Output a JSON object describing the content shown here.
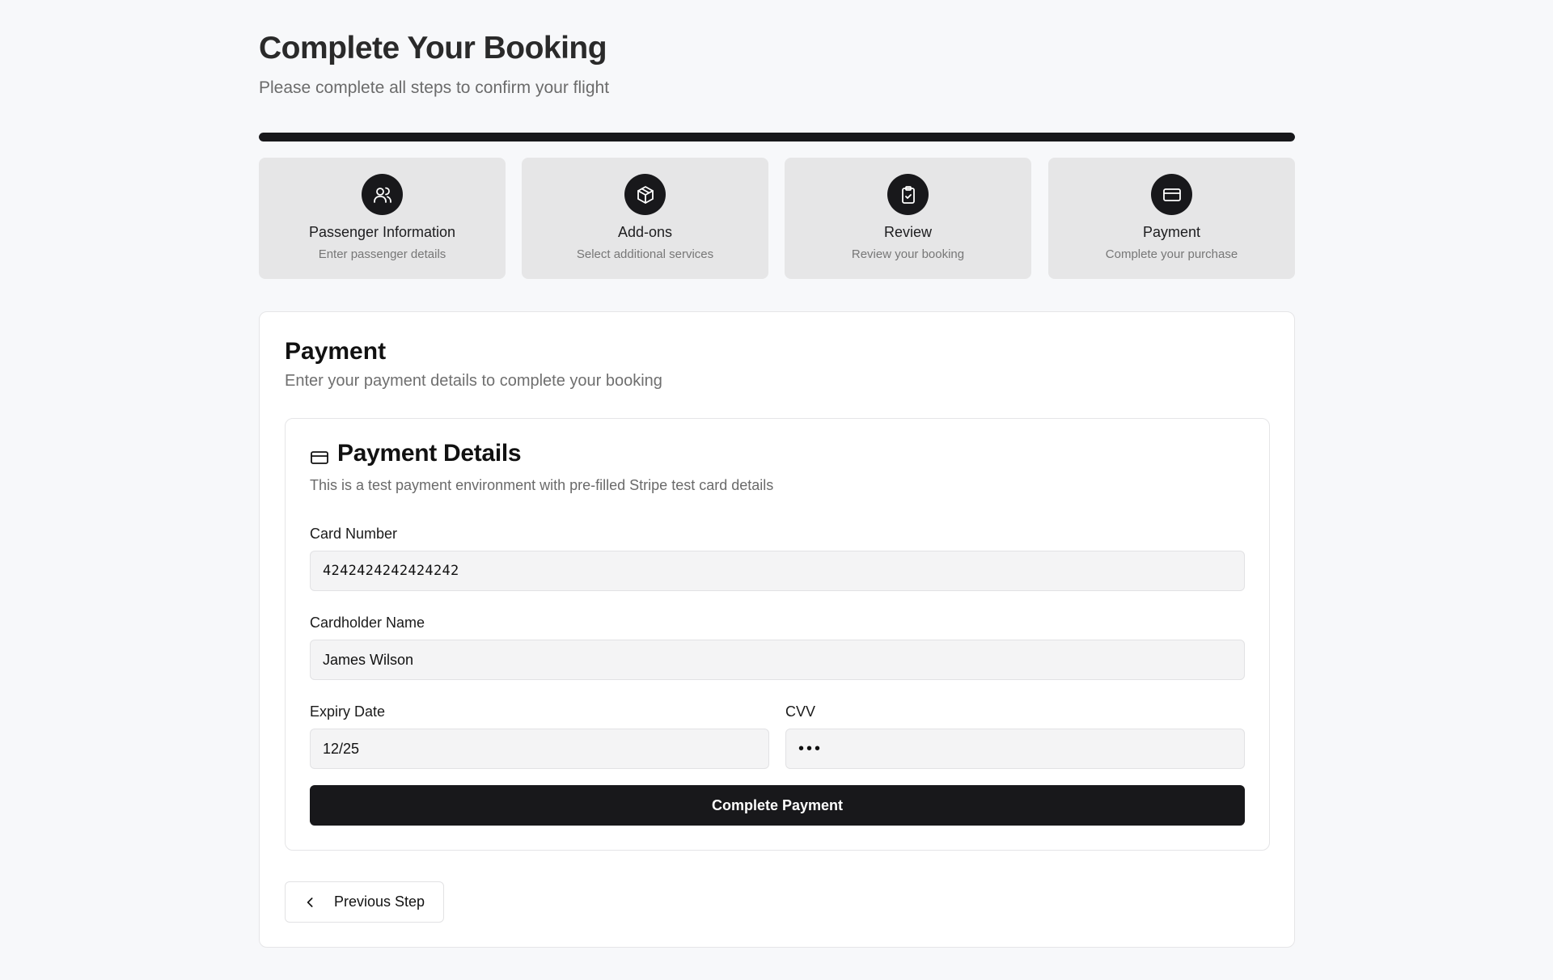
{
  "header": {
    "title": "Complete Your Booking",
    "subtitle": "Please complete all steps to confirm your flight"
  },
  "progress": {
    "fraction": 1.0
  },
  "steps": [
    {
      "title": "Passenger Information",
      "description": "Enter passenger details",
      "icon": "users-icon"
    },
    {
      "title": "Add-ons",
      "description": "Select additional services",
      "icon": "package-icon"
    },
    {
      "title": "Review",
      "description": "Review your booking",
      "icon": "clipboard-check-icon"
    },
    {
      "title": "Payment",
      "description": "Complete your purchase",
      "icon": "credit-card-icon"
    }
  ],
  "payment_section": {
    "title": "Payment",
    "subtitle": "Enter your payment details to complete your booking",
    "details": {
      "icon": "credit-card-icon",
      "title": "Payment Details",
      "subtitle": "This is a test payment environment with pre-filled Stripe test card details",
      "card_number": {
        "label": "Card Number",
        "value": "4242424242424242"
      },
      "cardholder_name": {
        "label": "Cardholder Name",
        "value": "James Wilson"
      },
      "expiry_date": {
        "label": "Expiry Date",
        "value": "12/25"
      },
      "cvv": {
        "label": "CVV",
        "value": "123"
      },
      "submit_label": "Complete Payment"
    },
    "previous_label": "Previous Step"
  },
  "colors": {
    "accent": "#18181b",
    "background": "#f7f8fa",
    "step_card": "#e6e6e7",
    "input_bg": "#f4f4f5"
  }
}
